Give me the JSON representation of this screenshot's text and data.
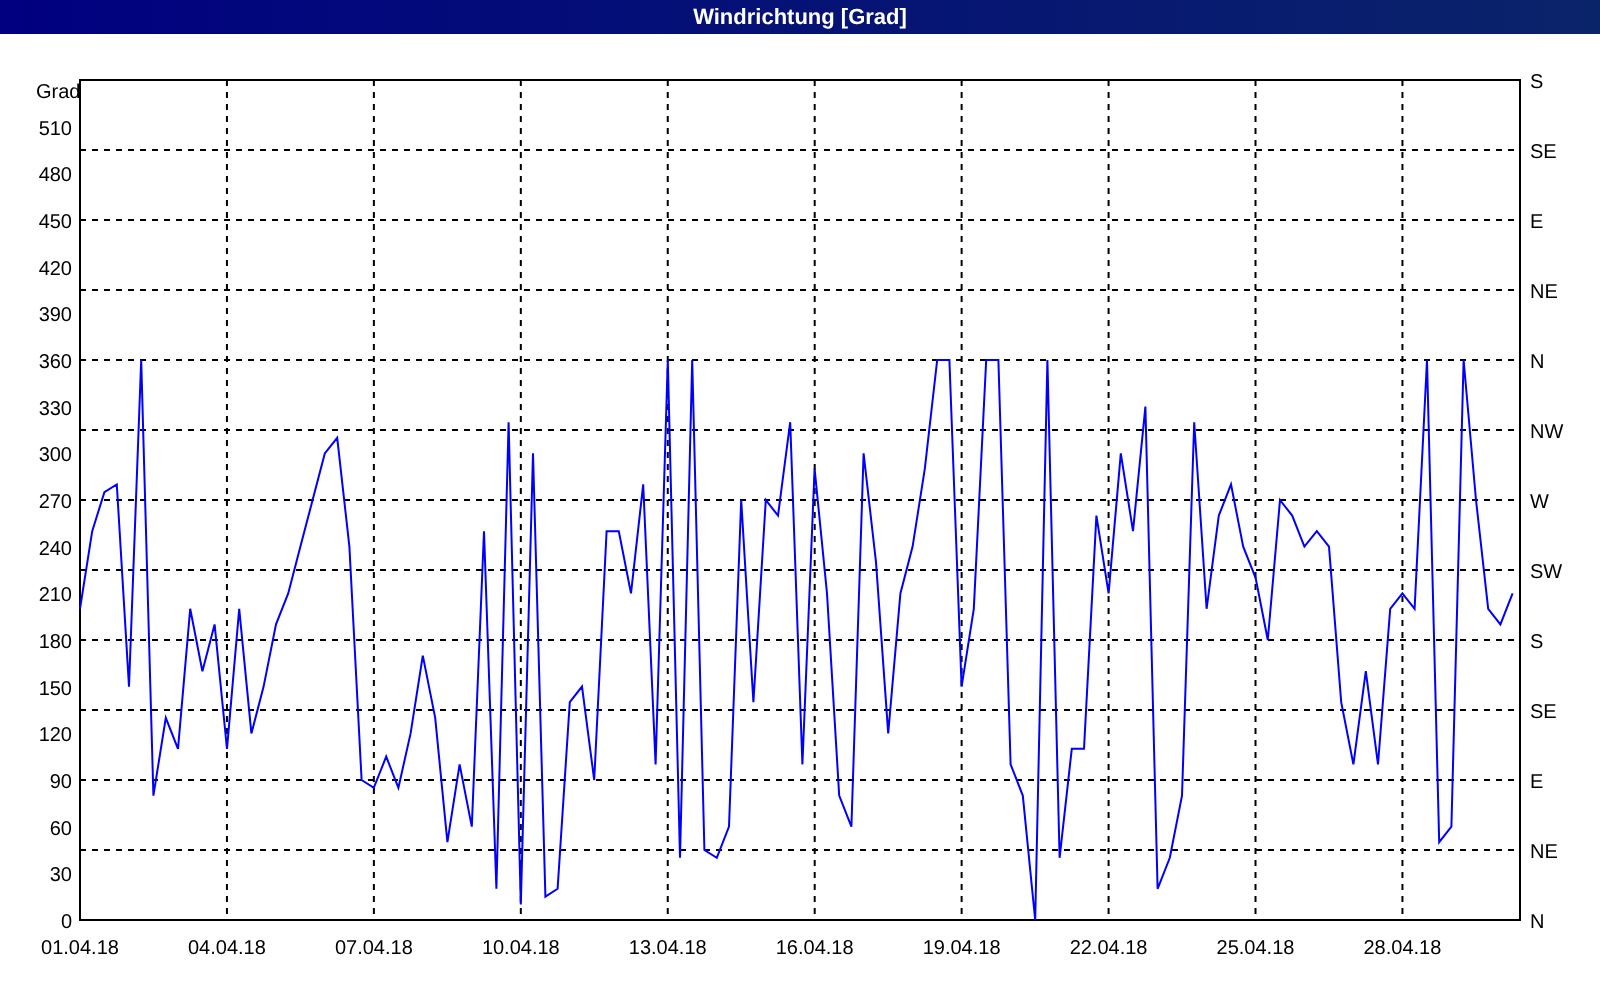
{
  "window": {
    "title": "Windrichtung [Grad]"
  },
  "chart": {
    "compass_labels": [
      "S",
      "SE",
      "E",
      "NE",
      "N",
      "NW",
      "W",
      "SW",
      "S",
      "SE",
      "E",
      "NE",
      "N"
    ],
    "chart_data": {
      "type": "line",
      "grid": true,
      "ylabel": "Grad",
      "ylim": [
        0,
        540
      ],
      "yticks": [
        0,
        30,
        60,
        90,
        120,
        150,
        180,
        210,
        240,
        270,
        300,
        330,
        360,
        390,
        420,
        450,
        480,
        510
      ],
      "categories": [
        "01.04.18",
        null,
        null,
        null,
        null,
        null,
        null,
        null,
        null,
        null,
        null,
        null,
        "04.04.18",
        null,
        null,
        null,
        null,
        null,
        null,
        null,
        null,
        null,
        null,
        null,
        "07.04.18",
        null,
        null,
        null,
        null,
        null,
        null,
        null,
        null,
        null,
        null,
        null,
        "10.04.18",
        null,
        null,
        null,
        null,
        null,
        null,
        null,
        null,
        null,
        null,
        null,
        "13.04.18",
        null,
        null,
        null,
        null,
        null,
        null,
        null,
        null,
        null,
        null,
        null,
        "16.04.18",
        null,
        null,
        null,
        null,
        null,
        null,
        null,
        null,
        null,
        null,
        null,
        "19.04.18",
        null,
        null,
        null,
        null,
        null,
        null,
        null,
        null,
        null,
        null,
        null,
        "22.04.18",
        null,
        null,
        null,
        null,
        null,
        null,
        null,
        null,
        null,
        null,
        null,
        "25.04.18",
        null,
        null,
        null,
        null,
        null,
        null,
        null,
        null,
        null,
        null,
        null,
        "28.04.18",
        null,
        null,
        null,
        null,
        null,
        null,
        null,
        null,
        null
      ],
      "series": [
        {
          "color": "#0000ff",
          "values": [
            200,
            250,
            275,
            280,
            150,
            360,
            80,
            130,
            110,
            200,
            160,
            190,
            110,
            200,
            120,
            150,
            190,
            210,
            240,
            270,
            300,
            310,
            240,
            90,
            85,
            105,
            85,
            120,
            170,
            130,
            50,
            100,
            60,
            250,
            20,
            320,
            10,
            300,
            15,
            20,
            140,
            150,
            90,
            250,
            250,
            210,
            280,
            100,
            360,
            40,
            360,
            45,
            40,
            60,
            270,
            140,
            270,
            260,
            320,
            100,
            290,
            210,
            80,
            60,
            300,
            230,
            120,
            210,
            240,
            290,
            360,
            360,
            150,
            200,
            360,
            360,
            100,
            80,
            0,
            360,
            40,
            110,
            110,
            260,
            210,
            300,
            250,
            330,
            20,
            40,
            80,
            320,
            200,
            260,
            280,
            240,
            220,
            180,
            270,
            260,
            240,
            250,
            240,
            140,
            100,
            160,
            100,
            200,
            210,
            200,
            360,
            50,
            60,
            360,
            270,
            200,
            190,
            210
          ]
        }
      ]
    }
  }
}
